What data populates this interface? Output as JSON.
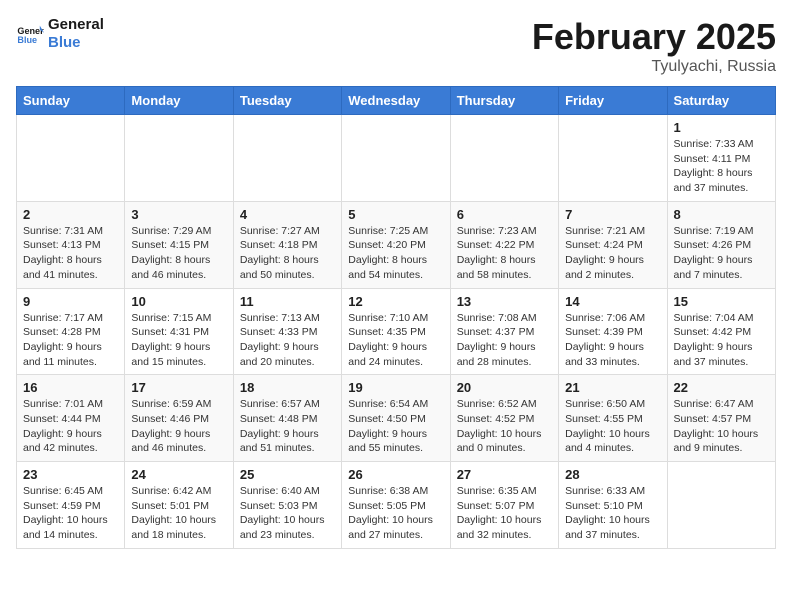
{
  "logo": {
    "line1": "General",
    "line2": "Blue"
  },
  "title": "February 2025",
  "subtitle": "Tyulyachi, Russia",
  "weekdays": [
    "Sunday",
    "Monday",
    "Tuesday",
    "Wednesday",
    "Thursday",
    "Friday",
    "Saturday"
  ],
  "weeks": [
    [
      {
        "day": "",
        "info": ""
      },
      {
        "day": "",
        "info": ""
      },
      {
        "day": "",
        "info": ""
      },
      {
        "day": "",
        "info": ""
      },
      {
        "day": "",
        "info": ""
      },
      {
        "day": "",
        "info": ""
      },
      {
        "day": "1",
        "info": "Sunrise: 7:33 AM\nSunset: 4:11 PM\nDaylight: 8 hours and 37 minutes."
      }
    ],
    [
      {
        "day": "2",
        "info": "Sunrise: 7:31 AM\nSunset: 4:13 PM\nDaylight: 8 hours and 41 minutes."
      },
      {
        "day": "3",
        "info": "Sunrise: 7:29 AM\nSunset: 4:15 PM\nDaylight: 8 hours and 46 minutes."
      },
      {
        "day": "4",
        "info": "Sunrise: 7:27 AM\nSunset: 4:18 PM\nDaylight: 8 hours and 50 minutes."
      },
      {
        "day": "5",
        "info": "Sunrise: 7:25 AM\nSunset: 4:20 PM\nDaylight: 8 hours and 54 minutes."
      },
      {
        "day": "6",
        "info": "Sunrise: 7:23 AM\nSunset: 4:22 PM\nDaylight: 8 hours and 58 minutes."
      },
      {
        "day": "7",
        "info": "Sunrise: 7:21 AM\nSunset: 4:24 PM\nDaylight: 9 hours and 2 minutes."
      },
      {
        "day": "8",
        "info": "Sunrise: 7:19 AM\nSunset: 4:26 PM\nDaylight: 9 hours and 7 minutes."
      }
    ],
    [
      {
        "day": "9",
        "info": "Sunrise: 7:17 AM\nSunset: 4:28 PM\nDaylight: 9 hours and 11 minutes."
      },
      {
        "day": "10",
        "info": "Sunrise: 7:15 AM\nSunset: 4:31 PM\nDaylight: 9 hours and 15 minutes."
      },
      {
        "day": "11",
        "info": "Sunrise: 7:13 AM\nSunset: 4:33 PM\nDaylight: 9 hours and 20 minutes."
      },
      {
        "day": "12",
        "info": "Sunrise: 7:10 AM\nSunset: 4:35 PM\nDaylight: 9 hours and 24 minutes."
      },
      {
        "day": "13",
        "info": "Sunrise: 7:08 AM\nSunset: 4:37 PM\nDaylight: 9 hours and 28 minutes."
      },
      {
        "day": "14",
        "info": "Sunrise: 7:06 AM\nSunset: 4:39 PM\nDaylight: 9 hours and 33 minutes."
      },
      {
        "day": "15",
        "info": "Sunrise: 7:04 AM\nSunset: 4:42 PM\nDaylight: 9 hours and 37 minutes."
      }
    ],
    [
      {
        "day": "16",
        "info": "Sunrise: 7:01 AM\nSunset: 4:44 PM\nDaylight: 9 hours and 42 minutes."
      },
      {
        "day": "17",
        "info": "Sunrise: 6:59 AM\nSunset: 4:46 PM\nDaylight: 9 hours and 46 minutes."
      },
      {
        "day": "18",
        "info": "Sunrise: 6:57 AM\nSunset: 4:48 PM\nDaylight: 9 hours and 51 minutes."
      },
      {
        "day": "19",
        "info": "Sunrise: 6:54 AM\nSunset: 4:50 PM\nDaylight: 9 hours and 55 minutes."
      },
      {
        "day": "20",
        "info": "Sunrise: 6:52 AM\nSunset: 4:52 PM\nDaylight: 10 hours and 0 minutes."
      },
      {
        "day": "21",
        "info": "Sunrise: 6:50 AM\nSunset: 4:55 PM\nDaylight: 10 hours and 4 minutes."
      },
      {
        "day": "22",
        "info": "Sunrise: 6:47 AM\nSunset: 4:57 PM\nDaylight: 10 hours and 9 minutes."
      }
    ],
    [
      {
        "day": "23",
        "info": "Sunrise: 6:45 AM\nSunset: 4:59 PM\nDaylight: 10 hours and 14 minutes."
      },
      {
        "day": "24",
        "info": "Sunrise: 6:42 AM\nSunset: 5:01 PM\nDaylight: 10 hours and 18 minutes."
      },
      {
        "day": "25",
        "info": "Sunrise: 6:40 AM\nSunset: 5:03 PM\nDaylight: 10 hours and 23 minutes."
      },
      {
        "day": "26",
        "info": "Sunrise: 6:38 AM\nSunset: 5:05 PM\nDaylight: 10 hours and 27 minutes."
      },
      {
        "day": "27",
        "info": "Sunrise: 6:35 AM\nSunset: 5:07 PM\nDaylight: 10 hours and 32 minutes."
      },
      {
        "day": "28",
        "info": "Sunrise: 6:33 AM\nSunset: 5:10 PM\nDaylight: 10 hours and 37 minutes."
      },
      {
        "day": "",
        "info": ""
      }
    ]
  ]
}
